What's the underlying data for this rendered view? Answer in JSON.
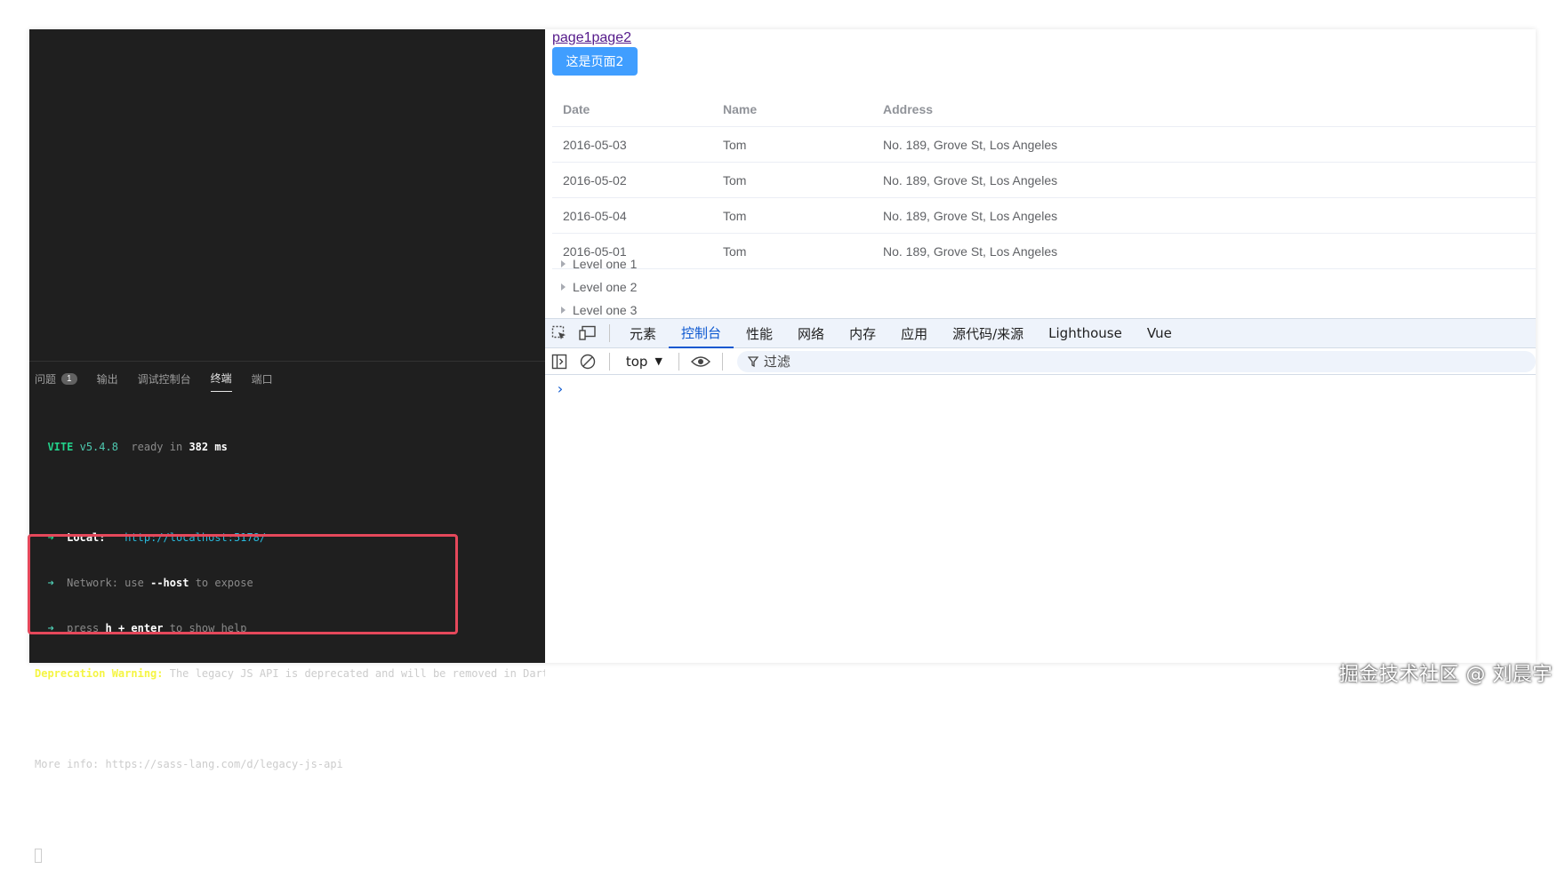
{
  "vscode": {
    "panel_tabs": [
      {
        "label": "问题",
        "badge": "1",
        "active": false
      },
      {
        "label": "输出",
        "active": false
      },
      {
        "label": "调试控制台",
        "active": false
      },
      {
        "label": "终端",
        "active": true
      },
      {
        "label": "端口",
        "active": false
      }
    ],
    "terminal": {
      "vite_name": "VITE",
      "vite_version": "v5.4.8",
      "ready_text": "ready in",
      "ready_ms": "382",
      "ms_unit": "ms",
      "local_label": "Local:",
      "local_url": "http://localhost:5178/",
      "network_label": "Network:",
      "network_use": "use",
      "network_flag": "--host",
      "network_rest": "to expose",
      "press": "press",
      "key": "h + enter",
      "help": "to show help",
      "warning_label": "Deprecation Warning:",
      "warning_text": "The legacy JS API is deprecated and will be removed in Dart S",
      "more_info": "More info: https://sass-lang.com/d/legacy-js-api"
    }
  },
  "browser": {
    "links": [
      "page1",
      "page2"
    ],
    "button_label": "这是页面2",
    "table": {
      "headers": [
        "Date",
        "Name",
        "Address"
      ],
      "rows": [
        [
          "2016-05-03",
          "Tom",
          "No. 189, Grove St, Los Angeles"
        ],
        [
          "2016-05-02",
          "Tom",
          "No. 189, Grove St, Los Angeles"
        ],
        [
          "2016-05-04",
          "Tom",
          "No. 189, Grove St, Los Angeles"
        ],
        [
          "2016-05-01",
          "Tom",
          "No. 189, Grove St, Los Angeles"
        ]
      ]
    },
    "tree": [
      "Level one 1",
      "Level one 2",
      "Level one 3"
    ]
  },
  "devtools": {
    "tabs": [
      {
        "label": "元素",
        "active": false
      },
      {
        "label": "控制台",
        "active": true
      },
      {
        "label": "性能",
        "active": false
      },
      {
        "label": "网络",
        "active": false
      },
      {
        "label": "内存",
        "active": false
      },
      {
        "label": "应用",
        "active": false
      },
      {
        "label": "源代码/来源",
        "active": false
      },
      {
        "label": "Lighthouse",
        "active": false
      },
      {
        "label": "Vue",
        "active": false
      }
    ],
    "context": "top",
    "filter_label": "过滤",
    "accent_color": "#0b57d0"
  },
  "watermark": "掘金技术社区 @ 刘晨宇"
}
